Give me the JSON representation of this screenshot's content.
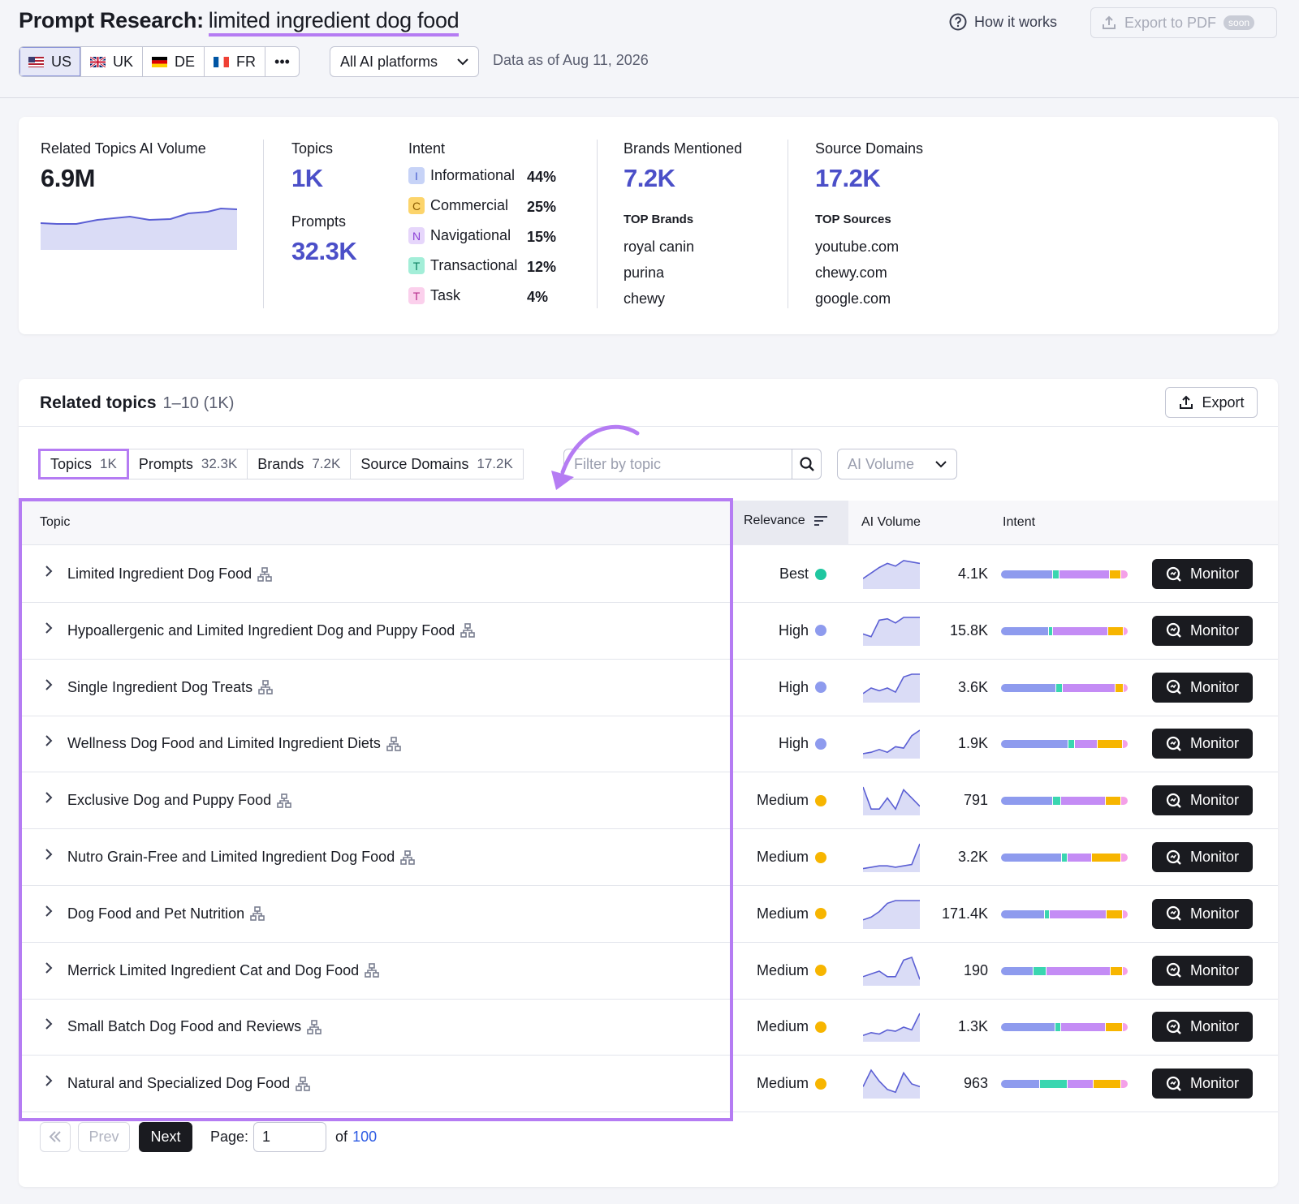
{
  "header": {
    "title_prefix": "Prompt Research:",
    "keyword": "limited ingredient dog food",
    "locations": [
      {
        "code": "US",
        "flag": "us-flag-icon"
      },
      {
        "code": "UK",
        "flag": "uk-flag-icon"
      },
      {
        "code": "DE",
        "flag": "de-flag-icon"
      },
      {
        "code": "FR",
        "flag": "fr-flag-icon"
      }
    ],
    "more_label": "•••",
    "platform_select": "All AI platforms",
    "data_as_of": "Data as of Aug 11, 2026",
    "how_it_works": "How it works",
    "export_pdf": "Export to PDF",
    "soon_badge": "soon"
  },
  "summary": {
    "ai_volume_label": "Related Topics AI Volume",
    "ai_volume_value": "6.9M",
    "topics_label": "Topics",
    "topics_value": "1K",
    "prompts_label": "Prompts",
    "prompts_value": "32.3K",
    "intent_label": "Intent",
    "intents": [
      {
        "letter": "I",
        "name": "Informational",
        "pct": "44%",
        "color": "#c7d3f7",
        "text": "#4b5fd0"
      },
      {
        "letter": "C",
        "name": "Commercial",
        "pct": "25%",
        "color": "#fcd46b",
        "text": "#8a5b00"
      },
      {
        "letter": "N",
        "name": "Navigational",
        "pct": "15%",
        "color": "#e6d6fb",
        "text": "#8b3fd6"
      },
      {
        "letter": "T",
        "name": "Transactional",
        "pct": "12%",
        "color": "#a3eed8",
        "text": "#0a7f5f"
      },
      {
        "letter": "T",
        "name": "Task",
        "pct": "4%",
        "color": "#fbd0ec",
        "text": "#b62d8d"
      }
    ],
    "brands_label": "Brands Mentioned",
    "brands_value": "7.2K",
    "top_brands_label": "TOP Brands",
    "top_brands": [
      "royal canin",
      "purina",
      "chewy"
    ],
    "sources_label": "Source Domains",
    "sources_value": "17.2K",
    "top_sources_label": "TOP Sources",
    "top_sources": [
      "youtube.com",
      "chewy.com",
      "google.com"
    ]
  },
  "related": {
    "title": "Related topics",
    "range": "1–10 (1K)",
    "export_label": "Export",
    "tabs": [
      {
        "label": "Topics",
        "count": "1K"
      },
      {
        "label": "Prompts",
        "count": "32.3K"
      },
      {
        "label": "Brands",
        "count": "7.2K"
      },
      {
        "label": "Source Domains",
        "count": "17.2K"
      }
    ],
    "filter_placeholder": "Filter by topic",
    "sort_select": "AI Volume",
    "columns": {
      "topic": "Topic",
      "relevance": "Relevance",
      "ai_volume": "AI Volume",
      "intent": "Intent"
    },
    "monitor_label": "Monitor",
    "rows": [
      {
        "topic": "Limited Ingredient Dog Food",
        "relevance": "Best",
        "dot": "#1fc7a0",
        "volume": "4.1K",
        "trend": [
          0.35,
          0.55,
          0.75,
          0.9,
          0.8,
          1,
          0.95,
          0.9
        ],
        "intent": [
          40,
          4,
          39,
          8,
          5
        ]
      },
      {
        "topic": "Hypoallergenic and Limited Ingredient Dog and Puppy Food",
        "relevance": "High",
        "dot": "#8e9bee",
        "volume": "15.8K",
        "trend": [
          0.4,
          0.3,
          0.9,
          0.95,
          0.8,
          1,
          1,
          1
        ],
        "intent": [
          38,
          3,
          44,
          12,
          3
        ]
      },
      {
        "topic": "Single Ingredient Dog Treats",
        "relevance": "High",
        "dot": "#8e9bee",
        "volume": "3.6K",
        "trend": [
          0.3,
          0.5,
          0.4,
          0.5,
          0.35,
          0.9,
          1,
          1
        ],
        "intent": [
          43,
          4,
          41,
          6,
          3
        ]
      },
      {
        "topic": "Wellness Dog Food and Limited Ingredient Diets",
        "relevance": "High",
        "dot": "#8e9bee",
        "volume": "1.9K",
        "trend": [
          0.15,
          0.2,
          0.3,
          0.2,
          0.4,
          0.35,
          0.8,
          1
        ],
        "intent": [
          51,
          4,
          17,
          18,
          4
        ]
      },
      {
        "topic": "Exclusive Dog and Puppy Food",
        "relevance": "Medium",
        "dot": "#f7b500",
        "volume": "791",
        "trend": [
          1,
          0.2,
          0.2,
          0.6,
          0.2,
          0.9,
          0.6,
          0.3
        ],
        "intent": [
          41,
          6,
          35,
          12,
          5
        ]
      },
      {
        "topic": "Nutro Grain-Free and Limited Ingredient Dog Food",
        "relevance": "Medium",
        "dot": "#f7b500",
        "volume": "3.2K",
        "trend": [
          0.1,
          0.15,
          0.2,
          0.2,
          0.15,
          0.2,
          0.25,
          1
        ],
        "intent": [
          46,
          4,
          18,
          22,
          5
        ]
      },
      {
        "topic": "Dog Food and Pet Nutrition",
        "relevance": "Medium",
        "dot": "#f7b500",
        "volume": "171.4K",
        "trend": [
          0.3,
          0.4,
          0.6,
          0.9,
          1,
          1,
          1,
          1
        ],
        "intent": [
          36,
          4,
          47,
          13,
          4
        ]
      },
      {
        "topic": "Merrick Limited Ingredient Cat and Dog Food",
        "relevance": "Medium",
        "dot": "#f7b500",
        "volume": "190",
        "trend": [
          0.3,
          0.4,
          0.5,
          0.3,
          0.3,
          0.9,
          1,
          0.2
        ],
        "intent": [
          26,
          10,
          52,
          9,
          4
        ]
      },
      {
        "topic": "Small Batch Dog Food and Reviews",
        "relevance": "Medium",
        "dot": "#f7b500",
        "volume": "1.3K",
        "trend": [
          0.2,
          0.3,
          0.25,
          0.4,
          0.35,
          0.5,
          0.4,
          1
        ],
        "intent": [
          44,
          4,
          36,
          13,
          4
        ]
      },
      {
        "topic": "Natural and Specialized Dog Food",
        "relevance": "Medium",
        "dot": "#f7b500",
        "volume": "963",
        "trend": [
          0.4,
          1,
          0.6,
          0.3,
          0.2,
          0.9,
          0.5,
          0.4
        ],
        "intent": [
          30,
          21,
          20,
          21,
          5
        ]
      }
    ],
    "pagination": {
      "prev": "Prev",
      "next": "Next",
      "page_label": "Page:",
      "page": "1",
      "of_label": "of",
      "total": "100"
    }
  },
  "intent_colors": [
    "#8e9bee",
    "#3ad6b0",
    "#c48cf5",
    "#f7b500",
    "#f4a0e8"
  ]
}
